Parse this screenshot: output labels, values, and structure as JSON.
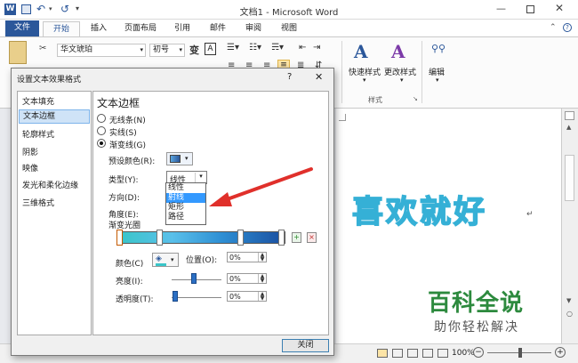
{
  "window": {
    "title": "文档1 - Microsoft Word"
  },
  "qat": {
    "undo": "↶",
    "redo": "↺"
  },
  "tabs": {
    "file": "文件",
    "items": [
      "开始",
      "插入",
      "页面布局",
      "引用",
      "邮件",
      "审阅",
      "视图"
    ]
  },
  "ribbon": {
    "paste": "粘贴",
    "font_name": "华文琥珀",
    "font_size": "初号",
    "wen": "变",
    "quick_style": "快速样式",
    "change_style": "更改样式",
    "styles_group": "样式",
    "edit": "编辑"
  },
  "dialog": {
    "title": "设置文本效果格式",
    "help": "?",
    "close_x": "✕",
    "nav": [
      "文本填充",
      "文本边框",
      "轮廓样式",
      "阴影",
      "映像",
      "发光和柔化边缘",
      "三维格式"
    ],
    "section_title": "文本边框",
    "options": [
      "无线条(N)",
      "实线(S)",
      "渐变线(G)"
    ],
    "preset_label": "预设颜色(R):",
    "type_label": "类型(Y):",
    "type_value": "线性",
    "type_options": [
      "线性",
      "射线",
      "矩形",
      "路径"
    ],
    "direction_label": "方向(D):",
    "angle_label": "角度(E):",
    "gradient_stops_label": "渐变光圈",
    "color_label": "颜色(C)",
    "position_label": "位置(O):",
    "position_value": "0%",
    "brightness_label": "亮度(I):",
    "brightness_value": "0%",
    "transparency_label": "透明度(T):",
    "transparency_value": "0%",
    "close_button": "关闭"
  },
  "document": {
    "text": "喜欢就好",
    "mark": "↵"
  },
  "watermark": {
    "title": "百科全说",
    "subtitle": "助你轻松解决"
  },
  "status": {
    "zoom": "100%"
  },
  "colors": {
    "accent": "#2b579a",
    "file_tab": "#2b579a",
    "arrow": "#e0302b",
    "highlight": "#3399ff"
  }
}
